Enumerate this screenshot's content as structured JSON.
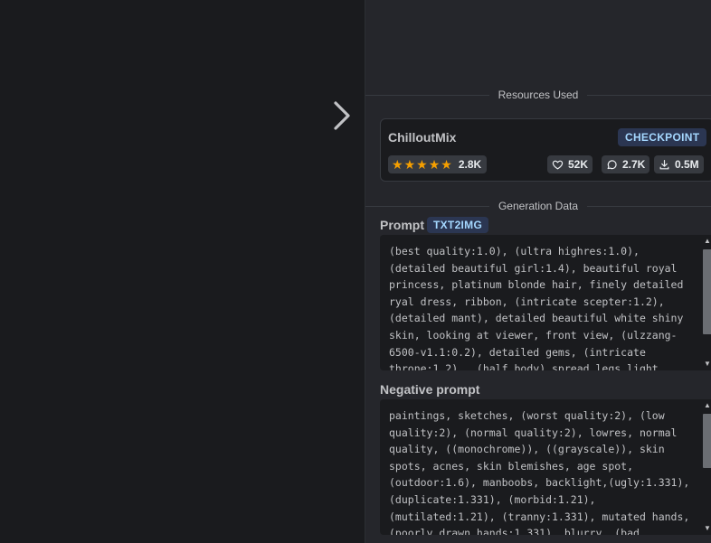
{
  "resources": {
    "section_label": "Resources Used",
    "items": [
      {
        "name": "ChilloutMix",
        "type": "CHECKPOINT",
        "rating": 5,
        "rating_count": "2.8K",
        "likes": "52K",
        "comments": "2.7K",
        "downloads": "0.5M"
      }
    ]
  },
  "generation": {
    "section_label": "Generation Data",
    "prompt_label": "Prompt",
    "mode": "TXT2IMG",
    "prompt": "(best quality:1.0), (ultra highres:1.0), (detailed beautiful girl:1.4), beautiful royal princess, platinum blonde hair, finely detailed ryal dress, ribbon, (intricate scepter:1.2), (detailed mant), detailed beautiful white shiny skin, looking at viewer, front view, (ulzzang-6500-v1.1:0.2), detailed gems, (intricate throne:1.2) , (half body) spread legs light smile tears",
    "negative_label": "Negative prompt",
    "negative_prompt": "paintings, sketches, (worst quality:2), (low quality:2), (normal quality:2), lowres, normal quality, ((monochrome)), ((grayscale)), skin spots, acnes, skin blemishes, age spot, (outdoor:1.6), manboobs, backlight,(ugly:1.331), (duplicate:1.331), (morbid:1.21), (mutilated:1.21), (tranny:1.331), mutated hands, (poorly drawn hands:1.331), blurry, (bad"
  },
  "icons": {
    "next": "chevron-right-icon",
    "star": "star-icon",
    "likes": "heart-icon",
    "comments": "message-circle-icon",
    "downloads": "download-icon"
  },
  "colors": {
    "background": "#1a1b1e",
    "panel": "#25262b",
    "badge_bg": "#2b3652",
    "badge_text": "#a5d8ff",
    "star": "#f59f00"
  }
}
